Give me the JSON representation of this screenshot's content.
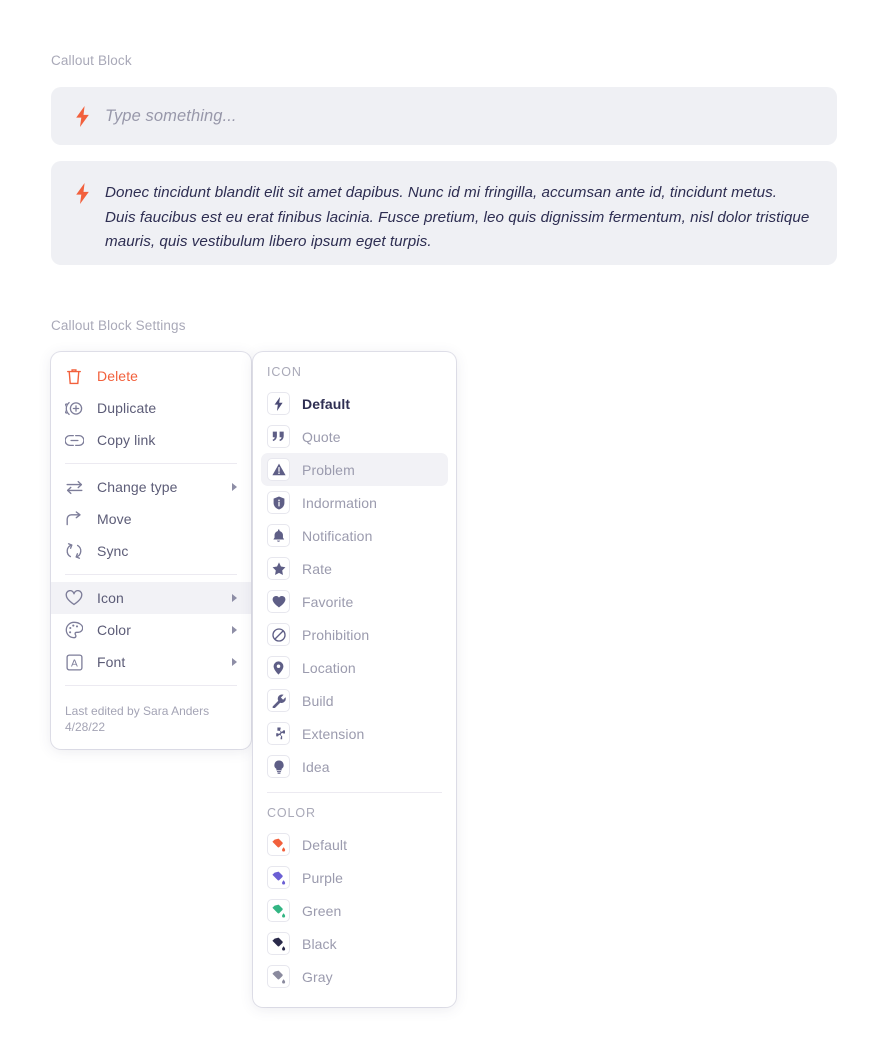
{
  "labels": {
    "callout_block": "Callout Block",
    "callout_settings": "Callout Block Settings"
  },
  "callout_empty": {
    "icon": "bolt-icon",
    "placeholder": "Type something..."
  },
  "callout_filled": {
    "icon": "bolt-icon",
    "text": "Donec tincidunt blandit elit sit amet dapibus. Nunc id mi fringilla, accumsan ante id, tincidunt metus. Duis faucibus est eu erat finibus lacinia. Fusce pretium, leo quis dignissim fermentum, nisl dolor tristique mauris, quis vestibulum libero ipsum eget turpis."
  },
  "context_menu": {
    "groups": [
      {
        "items": [
          {
            "label": "Delete",
            "icon": "trash-icon",
            "danger": true,
            "caret": false,
            "active": false
          },
          {
            "label": "Duplicate",
            "icon": "duplicate-icon",
            "danger": false,
            "caret": false,
            "active": false
          },
          {
            "label": "Copy link",
            "icon": "link-icon",
            "danger": false,
            "caret": false,
            "active": false
          }
        ]
      },
      {
        "items": [
          {
            "label": "Change type",
            "icon": "swap-icon",
            "danger": false,
            "caret": true,
            "active": false
          },
          {
            "label": "Move",
            "icon": "move-arrow-icon",
            "danger": false,
            "caret": false,
            "active": false
          },
          {
            "label": "Sync",
            "icon": "sync-icon",
            "danger": false,
            "caret": false,
            "active": false
          }
        ]
      },
      {
        "items": [
          {
            "label": "Icon",
            "icon": "heart-icon",
            "danger": false,
            "caret": true,
            "active": true
          },
          {
            "label": "Color",
            "icon": "palette-icon",
            "danger": false,
            "caret": true,
            "active": false
          },
          {
            "label": "Font",
            "icon": "font-a-icon",
            "danger": false,
            "caret": true,
            "active": false
          }
        ]
      }
    ],
    "footer": {
      "edited_by": "Last edited by Sara Anders",
      "date": "4/28/22"
    }
  },
  "icon_submenu": {
    "icon_header": "ICON",
    "icon_items": [
      {
        "label": "Default",
        "icon": "bolt-icon",
        "selected": true,
        "active": false
      },
      {
        "label": "Quote",
        "icon": "quote-icon",
        "selected": false,
        "active": false
      },
      {
        "label": "Problem",
        "icon": "warning-triangle-icon",
        "selected": false,
        "active": true
      },
      {
        "label": "Indormation",
        "icon": "shield-info-icon",
        "selected": false,
        "active": false
      },
      {
        "label": "Notification",
        "icon": "bell-icon",
        "selected": false,
        "active": false
      },
      {
        "label": "Rate",
        "icon": "star-icon",
        "selected": false,
        "active": false
      },
      {
        "label": "Favorite",
        "icon": "heart-filled-icon",
        "selected": false,
        "active": false
      },
      {
        "label": "Prohibition",
        "icon": "prohibition-icon",
        "selected": false,
        "active": false
      },
      {
        "label": "Location",
        "icon": "location-pin-icon",
        "selected": false,
        "active": false
      },
      {
        "label": "Build",
        "icon": "wrench-icon",
        "selected": false,
        "active": false
      },
      {
        "label": "Extension",
        "icon": "puzzle-icon",
        "selected": false,
        "active": false
      },
      {
        "label": "Idea",
        "icon": "lightbulb-icon",
        "selected": false,
        "active": false
      }
    ],
    "color_header": "COLOR",
    "color_items": [
      {
        "label": "Default",
        "icon": "paint-bucket-icon",
        "swatch": "#f2603c"
      },
      {
        "label": "Purple",
        "icon": "paint-bucket-icon",
        "swatch": "#6b5fd4"
      },
      {
        "label": "Green",
        "icon": "paint-bucket-icon",
        "swatch": "#33b583"
      },
      {
        "label": "Black",
        "icon": "paint-bucket-icon",
        "swatch": "#2a2a4a"
      },
      {
        "label": "Gray",
        "icon": "paint-bucket-icon",
        "swatch": "#8a8a9e"
      }
    ]
  },
  "colors": {
    "accent_orange": "#f2603c",
    "callout_bg": "#eff0f4",
    "text_dark": "#2e2e52",
    "text_muted": "#9b9bae",
    "highlight": "#f2f2f6"
  }
}
